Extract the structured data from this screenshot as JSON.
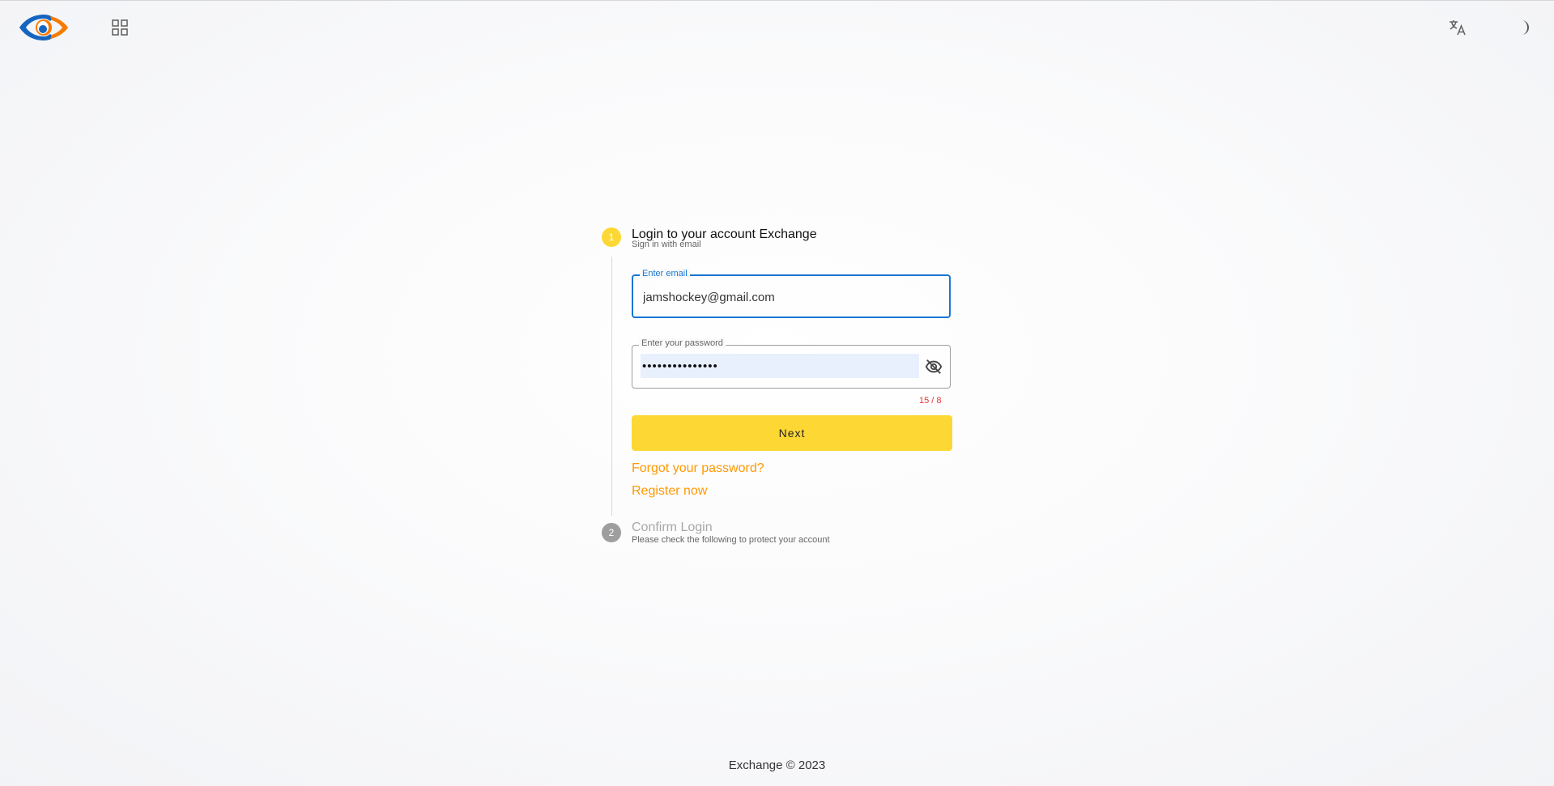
{
  "header": {
    "logo_icon": "eye-logo",
    "apps_icon": "grid-icon",
    "translate_icon": "translate-icon",
    "theme_icon": "moon-icon"
  },
  "stepper": {
    "step1": {
      "number": "1",
      "title": "Login to your account Exchange",
      "subtitle": "Sign in with email"
    },
    "step2": {
      "number": "2",
      "title": "Confirm Login",
      "subtitle": "Please check the following to protect your account"
    }
  },
  "form": {
    "email_label": "Enter email",
    "email_value": "jamshockey@gmail.com",
    "password_label": "Enter your password",
    "password_value": "•••••••••••••••",
    "password_counter": "15 / 8",
    "visibility_icon": "eye-off-icon",
    "next_label": "Next",
    "forgot_label": "Forgot your password?",
    "register_label": "Register now"
  },
  "colors": {
    "accent_yellow": "#fdd835",
    "link_orange": "#ff9800",
    "focus_blue": "#1976d2",
    "error_red": "#e53935"
  },
  "footer": {
    "text": "Exchange © 2023"
  }
}
